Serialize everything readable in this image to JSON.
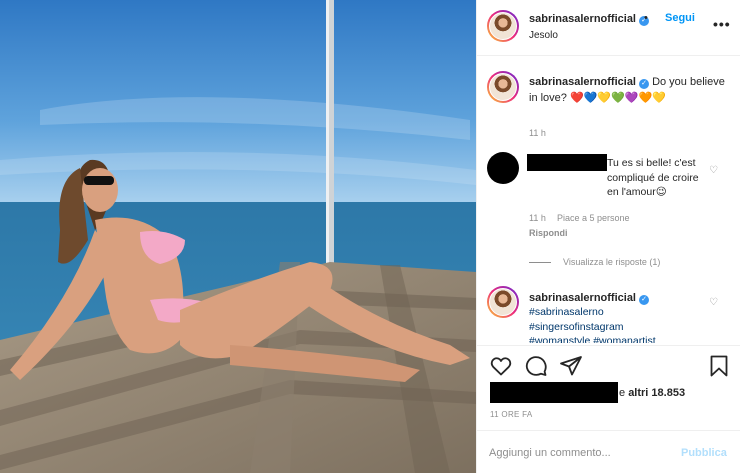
{
  "post": {
    "username": "sabrinasalernofficial",
    "follow_label": "Segui",
    "separator": "•",
    "location": "Jesolo",
    "more_label": "•••"
  },
  "caption": {
    "username": "sabrinasalernofficial",
    "text": "Do you believe in love? ❤️💙💛💚💜🧡💛",
    "time": "11 h"
  },
  "comment": {
    "text": "Tu es si belle! c'est compliqué de croire en l'amour😉",
    "time": "11 h",
    "likes": "Piace a 5 persone",
    "reply_label": "Rispondi",
    "view_replies_label": "Visualizza le risposte (1)"
  },
  "hashtag_comment": {
    "username": "sabrinasalernofficial",
    "tags": [
      "#sabrinasalerno",
      "#singersofinstagram",
      "#womanstyle #womanartist"
    ]
  },
  "likes": {
    "prefix": "e ",
    "label": "altri 18.853"
  },
  "post_time": "11 ORE FA",
  "comment_input": {
    "placeholder": "Aggiungi un commento...",
    "publish_label": "Pubblica"
  },
  "icons": [
    "heart-icon",
    "comment-icon",
    "share-icon",
    "bookmark-icon",
    "verified-icon",
    "more-icon"
  ],
  "colors": {
    "link": "#0095f6",
    "hashtag": "#00376b",
    "muted": "#8e8e8e",
    "verified": "#3897f0",
    "publish_disabled": "#b2dffc"
  }
}
